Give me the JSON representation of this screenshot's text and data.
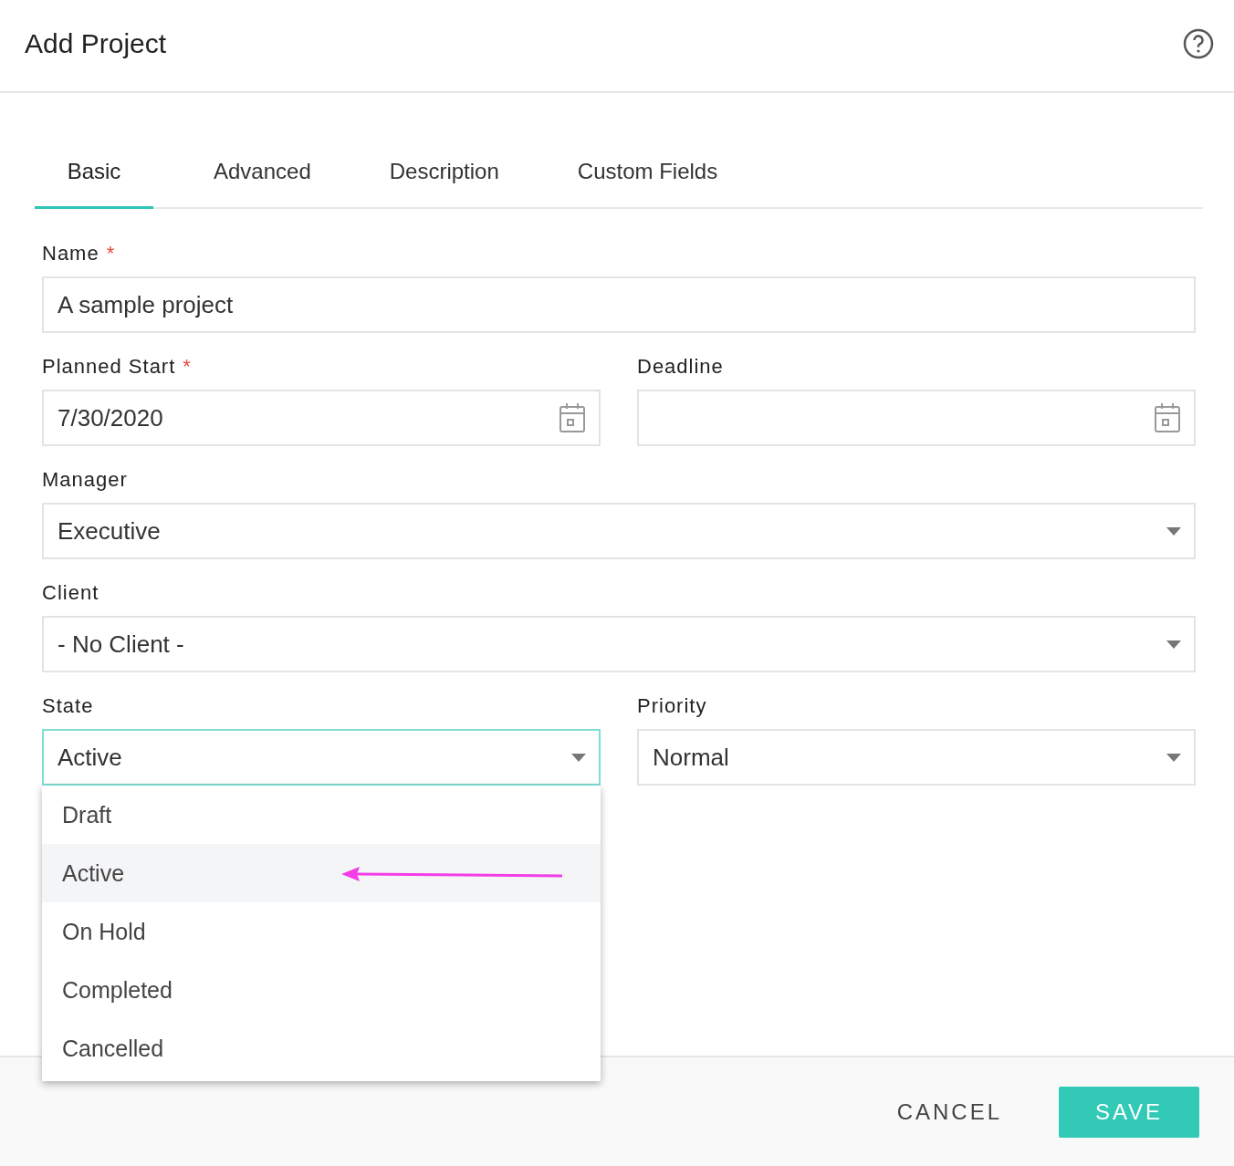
{
  "dialog": {
    "title": "Add Project"
  },
  "tabs": [
    {
      "label": "Basic",
      "selected": true
    },
    {
      "label": "Advanced",
      "selected": false
    },
    {
      "label": "Description",
      "selected": false
    },
    {
      "label": "Custom Fields",
      "selected": false
    }
  ],
  "rows": [
    [
      {
        "kind": "text",
        "label": "Name",
        "required_mark": "*",
        "value": "A sample project"
      }
    ],
    [
      {
        "kind": "date",
        "label": "Planned Start",
        "required_mark": "*",
        "value": "7/30/2020"
      },
      {
        "kind": "date",
        "label": "Deadline"
      }
    ],
    [
      {
        "kind": "select",
        "label": "Manager",
        "value": "Executive",
        "open": false
      }
    ],
    [
      {
        "kind": "select",
        "label": "Client",
        "value": "- No Client -",
        "open": false
      }
    ],
    [
      {
        "kind": "select",
        "label": "State",
        "value": "Active",
        "open": true,
        "options": [
          {
            "label": "Draft",
            "selected": false
          },
          {
            "label": "Active",
            "selected": true
          },
          {
            "label": "On Hold",
            "selected": false
          },
          {
            "label": "Completed",
            "selected": false
          },
          {
            "label": "Cancelled",
            "selected": false
          }
        ]
      },
      {
        "kind": "select",
        "label": "Priority",
        "value": "Normal",
        "open": false
      }
    ]
  ],
  "buttons": {
    "cancel": "CANCEL",
    "save": "SAVE"
  }
}
